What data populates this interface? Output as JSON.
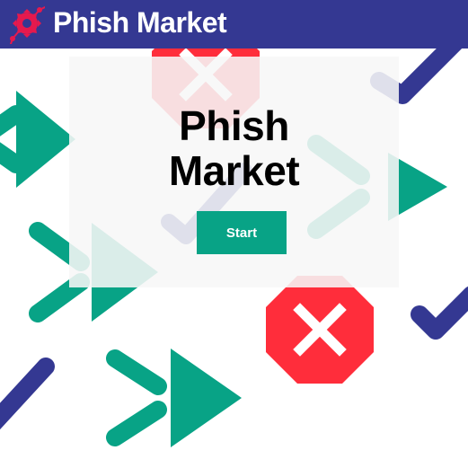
{
  "header": {
    "title": "Phish Market",
    "logo_icon": "gear-icon",
    "background_color": "#343892"
  },
  "card": {
    "title_line_1": "Phish",
    "title_line_2": "Market",
    "start_label": "Start",
    "start_button_color": "#08a386"
  },
  "background_icons": {
    "arrow_icon": "double-chevron-arrow-icon",
    "x_icon": "red-octagon-x-icon",
    "check_icon": "checkmark-icon"
  },
  "colors": {
    "teal": "#08a386",
    "red": "#ff2d3b",
    "navy": "#343892",
    "white": "#ffffff"
  }
}
